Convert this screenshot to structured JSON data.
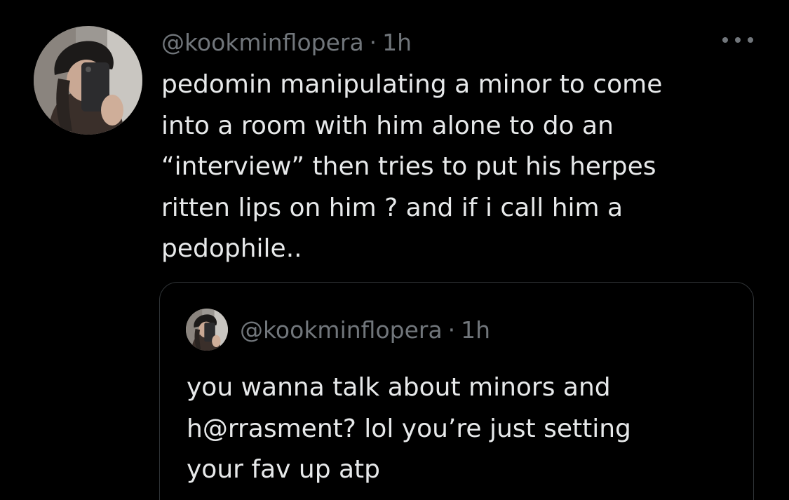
{
  "tweet": {
    "author": {
      "handle": "@kookminflopera",
      "time": "1h",
      "avatar_icon": "profile-photo-avatar"
    },
    "separator": "·",
    "more_icon": "more-options-icon",
    "text_lines": [
      "pedomin manipulating a minor to come",
      "into a room with him alone to do an",
      "“interview” then tries to put his herpes",
      "ritten lips on him ? and if i call him a",
      "pedophile.."
    ]
  },
  "quoted_tweet": {
    "author": {
      "handle": "@kookminflopera",
      "time": "1h",
      "avatar_icon": "profile-photo-avatar"
    },
    "separator": "·",
    "text_lines": [
      "you wanna talk about minors and",
      "h@rrasment? lol you’re just setting",
      "your fav up atp"
    ]
  },
  "colors": {
    "background": "#000000",
    "primary_text": "#e7e9ea",
    "secondary_text": "#71767b",
    "border": "#2f3336"
  }
}
